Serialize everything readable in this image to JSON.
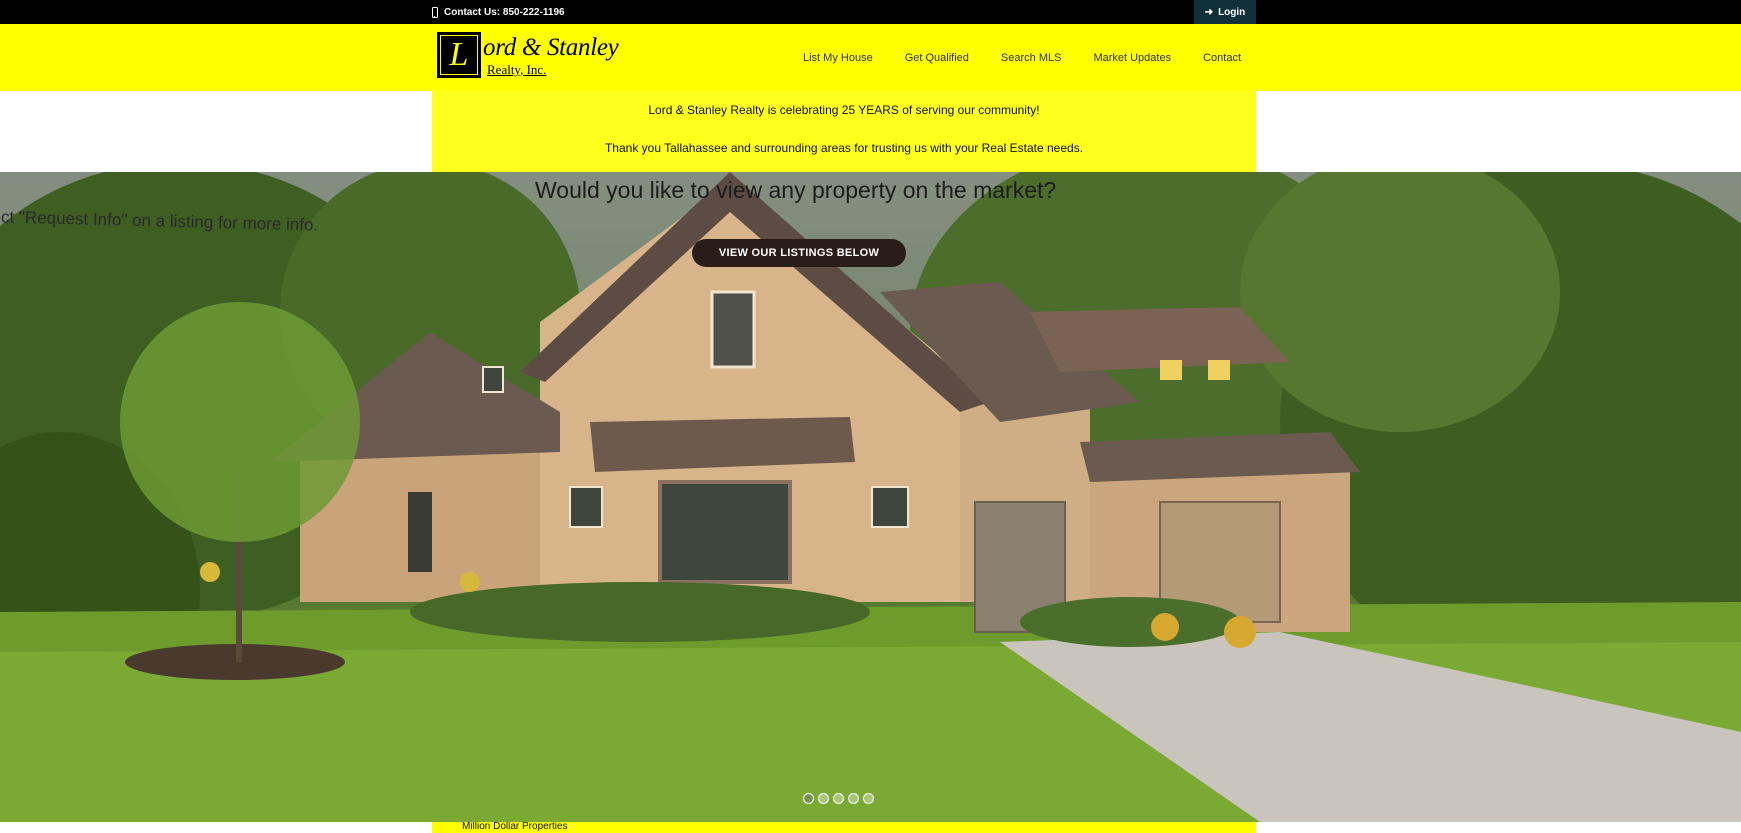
{
  "topbar": {
    "contact_label": "Contact Us: 850-222-1196",
    "contact_icon": "phone-icon",
    "login_label": "Login",
    "login_icon": "login-icon"
  },
  "header": {
    "logo_text_main": "ord & Stanley",
    "logo_initial": "L",
    "logo_text_sub": "Realty, Inc.",
    "nav": [
      {
        "label": "List My House"
      },
      {
        "label": "Get Qualified"
      },
      {
        "label": "Search MLS"
      },
      {
        "label": "Market Updates"
      },
      {
        "label": "Contact"
      }
    ]
  },
  "announcement": {
    "line1": "Lord & Stanley Realty is celebrating 25 YEARS of serving our community!",
    "line2": "Thank you Tallahassee and surrounding areas for trusting us with your Real Estate needs."
  },
  "hero": {
    "heading": "Would you like to view any property on the market?",
    "subtext": "lect \"Request Info\" on a listing for more info.",
    "cta_label": "VIEW OUR LISTINGS BELOW",
    "slides_count": 5,
    "active_slide": 1
  },
  "bottom": {
    "label": "Million Dollar Properties"
  },
  "colors": {
    "brand_yellow": "#ffff00",
    "topbar_black": "#000000",
    "login_bg": "#0f2f3b",
    "cta_bg": "#2a1c17"
  }
}
